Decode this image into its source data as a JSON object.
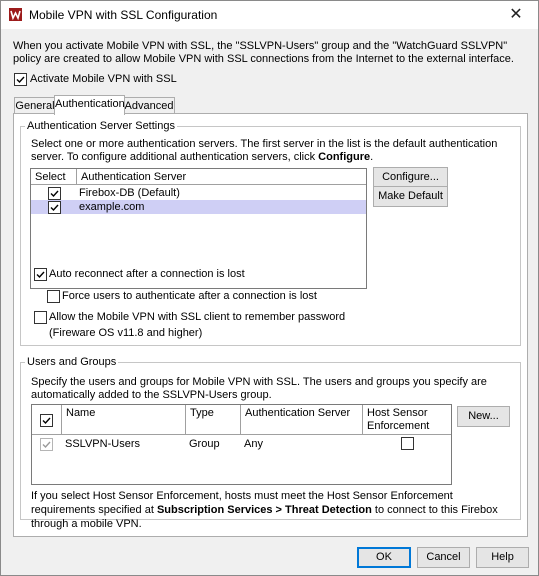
{
  "window": {
    "title": "Mobile VPN with SSL Configuration",
    "close_glyph": "✕",
    "icon": "app-logo-icon"
  },
  "intro_text": "When you activate Mobile VPN with SSL, the \"SSLVPN-Users\" group and the \"WatchGuard SSLVPN\" policy are created to allow Mobile VPN with SSL connections from the Internet to the external interface.",
  "activate": {
    "label": "Activate Mobile VPN with SSL",
    "checked": true
  },
  "tabs": [
    {
      "label": "General",
      "active": false
    },
    {
      "label": "Authentication",
      "active": true
    },
    {
      "label": "Advanced",
      "active": false
    }
  ],
  "auth_servers": {
    "legend": "Authentication Server Settings",
    "desc_part1": "Select one or more authentication servers. The first server in the list is the default authentication server. To configure additional authentication servers, click ",
    "desc_bold": "Configure",
    "desc_part2": ".",
    "columns": [
      "Select",
      "Authentication Server"
    ],
    "rows": [
      {
        "name": "Firebox-DB  (Default)",
        "checked": true,
        "selected": false
      },
      {
        "name": "example.com",
        "checked": true,
        "selected": true
      }
    ],
    "configure_button": "Configure...",
    "make_default_button": "Make Default",
    "auto_reconnect": {
      "label": "Auto reconnect after a connection is lost",
      "checked": true
    },
    "force_reauth": {
      "label": "Force users to authenticate after a connection is lost",
      "checked": false
    },
    "remember_password": {
      "label": "Allow the Mobile VPN with SSL client to remember password",
      "checked": false
    },
    "remember_password_note": "(Fireware OS v11.8 and higher)"
  },
  "users_groups": {
    "legend": "Users and Groups",
    "desc": "Specify the users and groups for Mobile VPN with SSL. The users and groups you specify are automatically added to the SSLVPN-Users group.",
    "columns": [
      "Name",
      "Type",
      "Authentication Server",
      "Host Sensor Enforcement"
    ],
    "rows": [
      {
        "checked": true,
        "name": "SSLVPN-Users",
        "type": "Group",
        "server": "Any",
        "host_sensor": false
      }
    ],
    "new_button": "New...",
    "note_part1": "If you select Host Sensor Enforcement, hosts must meet the Host Sensor Enforcement requirements specified at ",
    "note_bold": "Subscription Services > Threat Detection",
    "note_part2": " to connect to this Firebox through a mobile VPN."
  },
  "footer": {
    "ok": "OK",
    "cancel": "Cancel",
    "help": "Help"
  },
  "colors": {
    "selection": "#cfcff5",
    "accent": "#0078d7"
  }
}
